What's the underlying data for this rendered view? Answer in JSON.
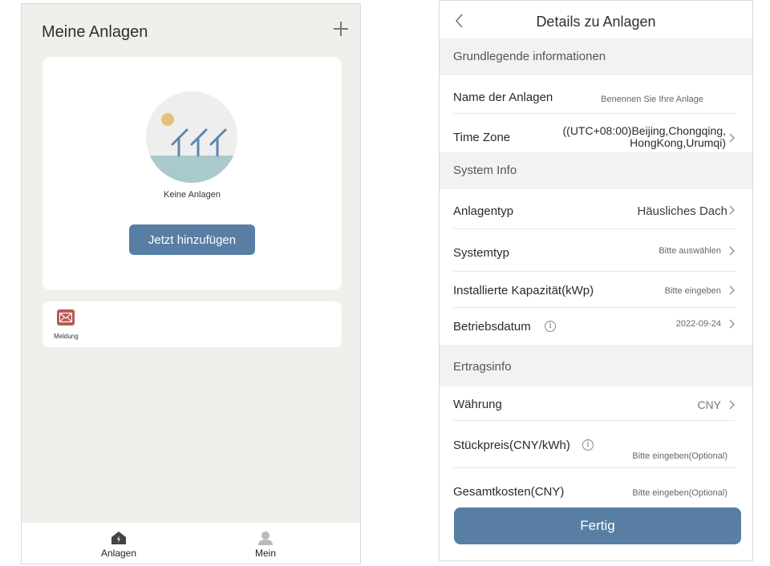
{
  "home": {
    "title": "Meine Anlagen",
    "empty_text": "Keine Anlagen",
    "add_button": "Jetzt hinzufügen",
    "message_label": "Meldung",
    "tabs": [
      {
        "label": "Anlagen",
        "icon": "home-bolt-icon"
      },
      {
        "label": "Mein",
        "icon": "user-icon"
      }
    ]
  },
  "details": {
    "title": "Details zu Anlagen",
    "sections": {
      "basic": "Grundlegende informationen",
      "system": "System Info",
      "yield": "Ertragsinfo"
    },
    "rows": {
      "name": {
        "label": "Name der Anlagen",
        "value": "Benennen Sie Ihre Anlage"
      },
      "timezone": {
        "label": "Time Zone",
        "value_line1": "((UTC+08:00)Beijing,Chongqing,",
        "value_line2": "HongKong,Urumqi)"
      },
      "plant_type": {
        "label": "Anlagentyp",
        "value": "Häusliches Dach"
      },
      "system_type": {
        "label": "Systemtyp",
        "value": "Bitte auswählen"
      },
      "capacity": {
        "label": "Installierte Kapazität(kWp)",
        "value": "Bitte eingeben"
      },
      "operation_date": {
        "label": "Betriebsdatum",
        "value": "2022-09-24"
      },
      "currency": {
        "label": "Währung",
        "value": "CNY"
      },
      "unit_price": {
        "label": "Stückpreis(CNY/kWh)",
        "value": "Bitte eingeben(Optional)"
      },
      "total_cost": {
        "label": "Gesamtkosten(CNY)",
        "value": "Bitte eingeben(Optional)"
      }
    },
    "done_button": "Fertig"
  },
  "colors": {
    "accent": "#587ea4",
    "message_icon": "#b55a57",
    "background": "#f1efeb"
  }
}
